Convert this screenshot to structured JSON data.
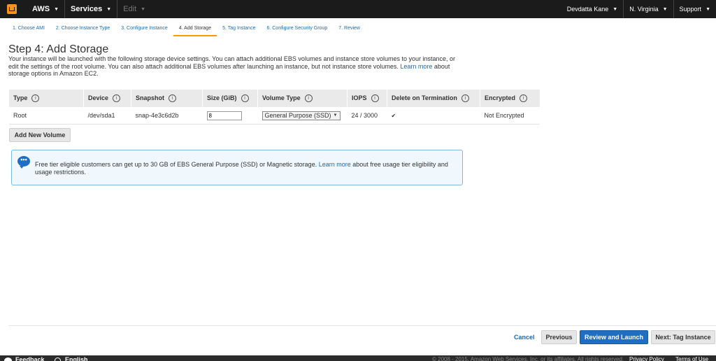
{
  "nav": {
    "aws": "AWS",
    "services": "Services",
    "edit": "Edit",
    "user": "Devdatta Kane",
    "region": "N. Virginia",
    "support": "Support"
  },
  "wizard": {
    "steps": [
      "1. Choose AMI",
      "2. Choose Instance Type",
      "3. Configure Instance",
      "4. Add Storage",
      "5. Tag Instance",
      "6. Configure Security Group",
      "7. Review"
    ]
  },
  "page": {
    "title": "Step 4: Add Storage",
    "desc_before_link": "Your instance will be launched with the following storage device settings. You can attach additional EBS volumes and instance store volumes to your instance, or edit the settings of the root volume. You can also attach additional EBS volumes after launching an instance, but not instance store volumes.",
    "desc_link": "Learn more",
    "desc_after_link": "about storage options in Amazon EC2."
  },
  "table": {
    "headers": [
      "Type",
      "Device",
      "Snapshot",
      "Size (GiB)",
      "Volume Type",
      "IOPS",
      "Delete on Termination",
      "Encrypted"
    ],
    "row": {
      "type": "Root",
      "device": "/dev/sda1",
      "snapshot": "snap-4e3c6d2b",
      "size": "8",
      "volume_type": "General Purpose (SSD)",
      "iops": "24 / 3000",
      "delete_on_termination": true,
      "encrypted": "Not Encrypted"
    }
  },
  "buttons": {
    "add_volume": "Add New Volume",
    "cancel": "Cancel",
    "previous": "Previous",
    "review_launch": "Review and Launch",
    "next": "Next: Tag Instance"
  },
  "notice": {
    "before_link": "Free tier eligible customers can get up to 30 GB of EBS General Purpose (SSD) or Magnetic storage.",
    "link": "Learn more",
    "after_link": "about free usage tier eligibility and usage restrictions."
  },
  "footer": {
    "feedback": "Feedback",
    "language": "English",
    "copyright": "© 2008 - 2015, Amazon Web Services, Inc. or its affiliates. All rights reserved.",
    "privacy": "Privacy Policy",
    "terms": "Terms of Use"
  }
}
